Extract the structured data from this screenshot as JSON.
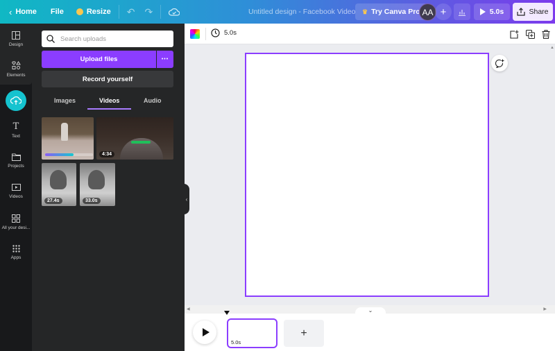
{
  "topbar": {
    "home_label": "Home",
    "file_label": "File",
    "resize_label": "Resize",
    "doc_title": "Untitled design - Facebook Video",
    "try_pro_label": "Try Canva Pro",
    "avatar_initials": "AA",
    "play_label": "5.0s",
    "share_label": "Share"
  },
  "sidenav": {
    "items": [
      {
        "label": "Design",
        "icon": "layout-icon"
      },
      {
        "label": "Elements",
        "icon": "shapes-icon"
      },
      {
        "label": "Uploads",
        "icon": "cloud-upload-icon"
      },
      {
        "label": "Text",
        "icon": "text-icon"
      },
      {
        "label": "Projects",
        "icon": "folder-icon"
      },
      {
        "label": "Videos",
        "icon": "video-icon"
      },
      {
        "label": "All your desi...",
        "icon": "grid-icon"
      },
      {
        "label": "Apps",
        "icon": "apps-icon"
      }
    ]
  },
  "panel": {
    "search_placeholder": "Search uploads",
    "upload_label": "Upload files",
    "more_label": "•••",
    "record_label": "Record yourself",
    "tabs": [
      {
        "label": "Images",
        "active": false
      },
      {
        "label": "Videos",
        "active": true
      },
      {
        "label": "Audio",
        "active": false
      }
    ],
    "videos": [
      {
        "description": "dog in room",
        "duration": "",
        "upload_progress": 0.6
      },
      {
        "description": "man with green tub",
        "duration": "4:34"
      },
      {
        "description": "girl with birthday cake",
        "duration": "27.4s"
      },
      {
        "description": "girl with birthday cake",
        "duration": "33.0s"
      }
    ]
  },
  "canvas_toolbar": {
    "duration_label": "5.0s"
  },
  "timeline": {
    "scene_duration": "5.0s",
    "add_label": "+"
  },
  "colors": {
    "accent": "#8b3dff",
    "upload_circle": "#15c3cf",
    "panel_bg": "#252627",
    "nav_bg": "#18191b"
  }
}
